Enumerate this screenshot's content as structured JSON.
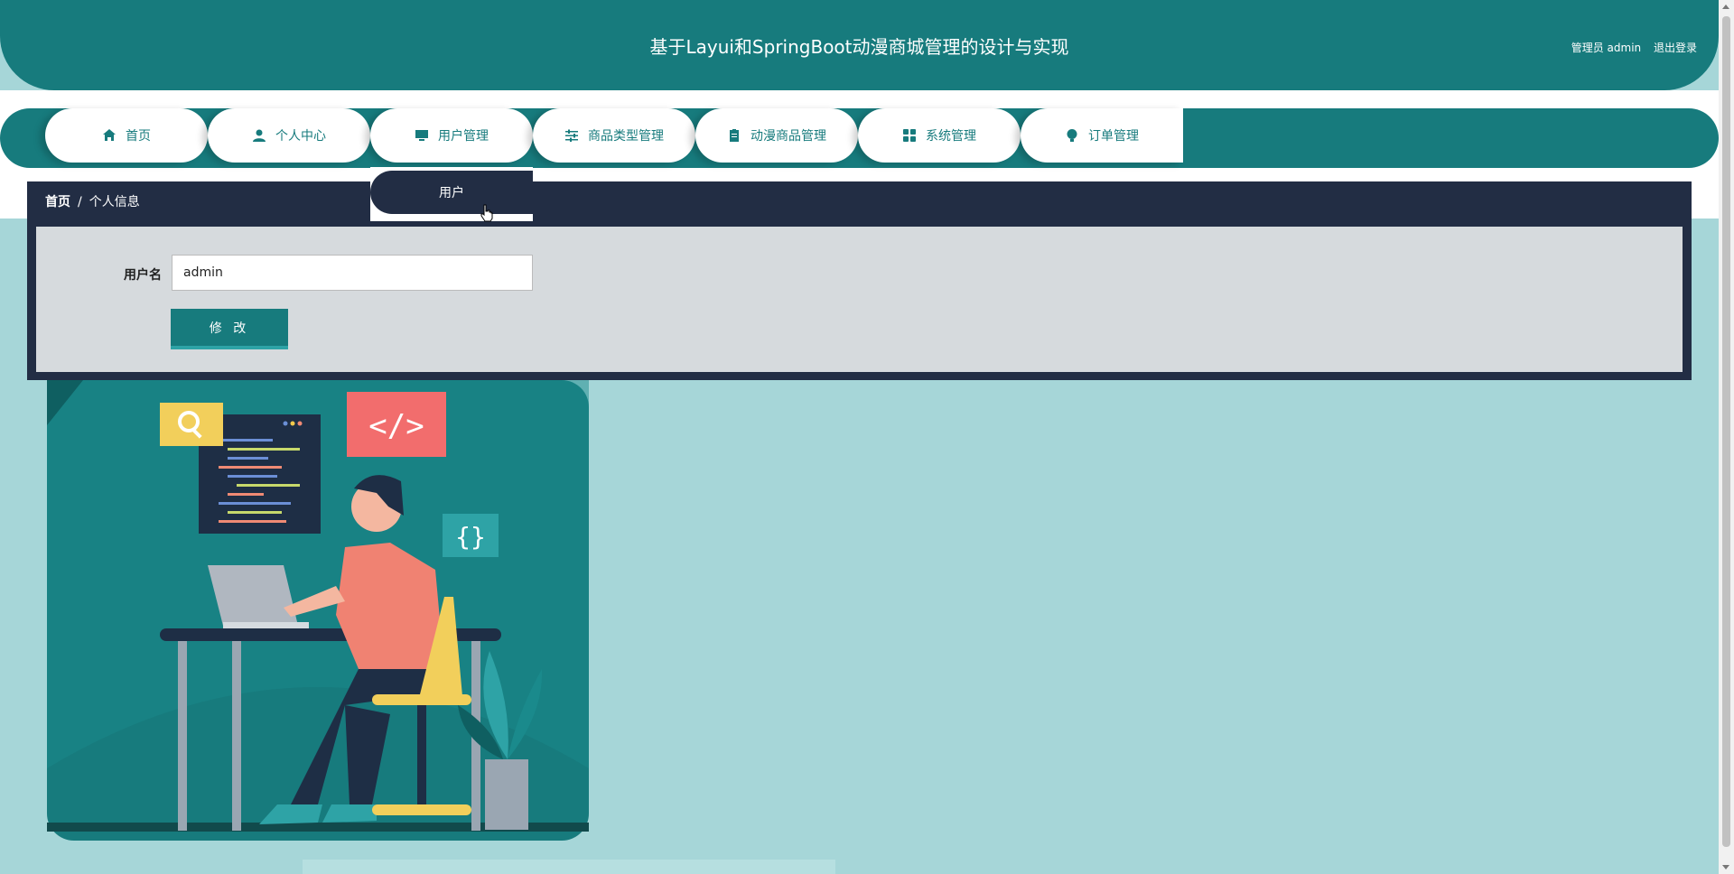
{
  "header": {
    "title": "基于Layui和SpringBoot动漫商城管理的设计与实现",
    "user_label": "管理员 admin",
    "logout_label": "退出登录"
  },
  "nav": {
    "items": [
      {
        "label": "首页",
        "icon": "home-icon"
      },
      {
        "label": "个人中心",
        "icon": "person-icon"
      },
      {
        "label": "用户管理",
        "icon": "monitor-icon"
      },
      {
        "label": "商品类型管理",
        "icon": "sliders-icon"
      },
      {
        "label": "动漫商品管理",
        "icon": "clipboard-icon"
      },
      {
        "label": "系统管理",
        "icon": "grid-icon"
      },
      {
        "label": "订单管理",
        "icon": "lightbulb-icon"
      }
    ],
    "dropdown_item": "用户"
  },
  "breadcrumb": {
    "home": "首页",
    "separator": "/",
    "current": "个人信息"
  },
  "form": {
    "username_label": "用户名",
    "username_value": "admin",
    "submit_label": "修 改"
  },
  "colors": {
    "primary": "#177b7d",
    "dark": "#222d44",
    "background": "#a6d6d8",
    "panel": "#d6dadd"
  }
}
